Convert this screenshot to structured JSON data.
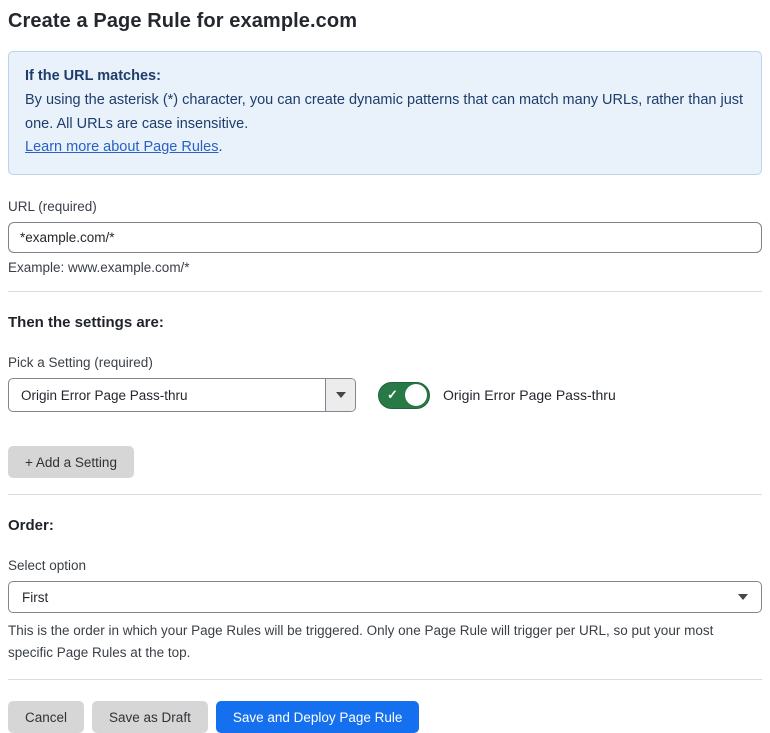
{
  "page": {
    "title": "Create a Page Rule for example.com"
  },
  "info_box": {
    "heading": "If the URL matches:",
    "body": "By using the asterisk (*) character, you can create dynamic patterns that can match many URLs, rather than just one. All URLs are case insensitive.",
    "link": "Learn more about Page Rules",
    "link_suffix": "."
  },
  "url_field": {
    "label": "URL (required)",
    "value": "*example.com/*",
    "hint": "Example: www.example.com/*"
  },
  "settings": {
    "heading": "Then the settings are:",
    "picker_label": "Pick a Setting (required)",
    "picker_value": "Origin Error Page Pass-thru",
    "toggle": {
      "state": "on",
      "check_glyph": "✓",
      "label": "Origin Error Page Pass-thru"
    },
    "add_button": "+ Add a Setting"
  },
  "order": {
    "heading": "Order:",
    "select_label": "Select option",
    "select_value": "First",
    "help": "This is the order in which your Page Rules will be triggered. Only one Page Rule will trigger per URL, so put your most specific Page Rules at the top."
  },
  "actions": {
    "cancel": "Cancel",
    "save_draft": "Save as Draft",
    "save_deploy": "Save and Deploy Page Rule"
  },
  "colors": {
    "accent_blue": "#1570ef",
    "toggle_green": "#277a45",
    "info_bg": "#e9f1fb",
    "info_border": "#bad3ee",
    "info_text": "#1d3d6b",
    "link_blue": "#2962c4"
  }
}
